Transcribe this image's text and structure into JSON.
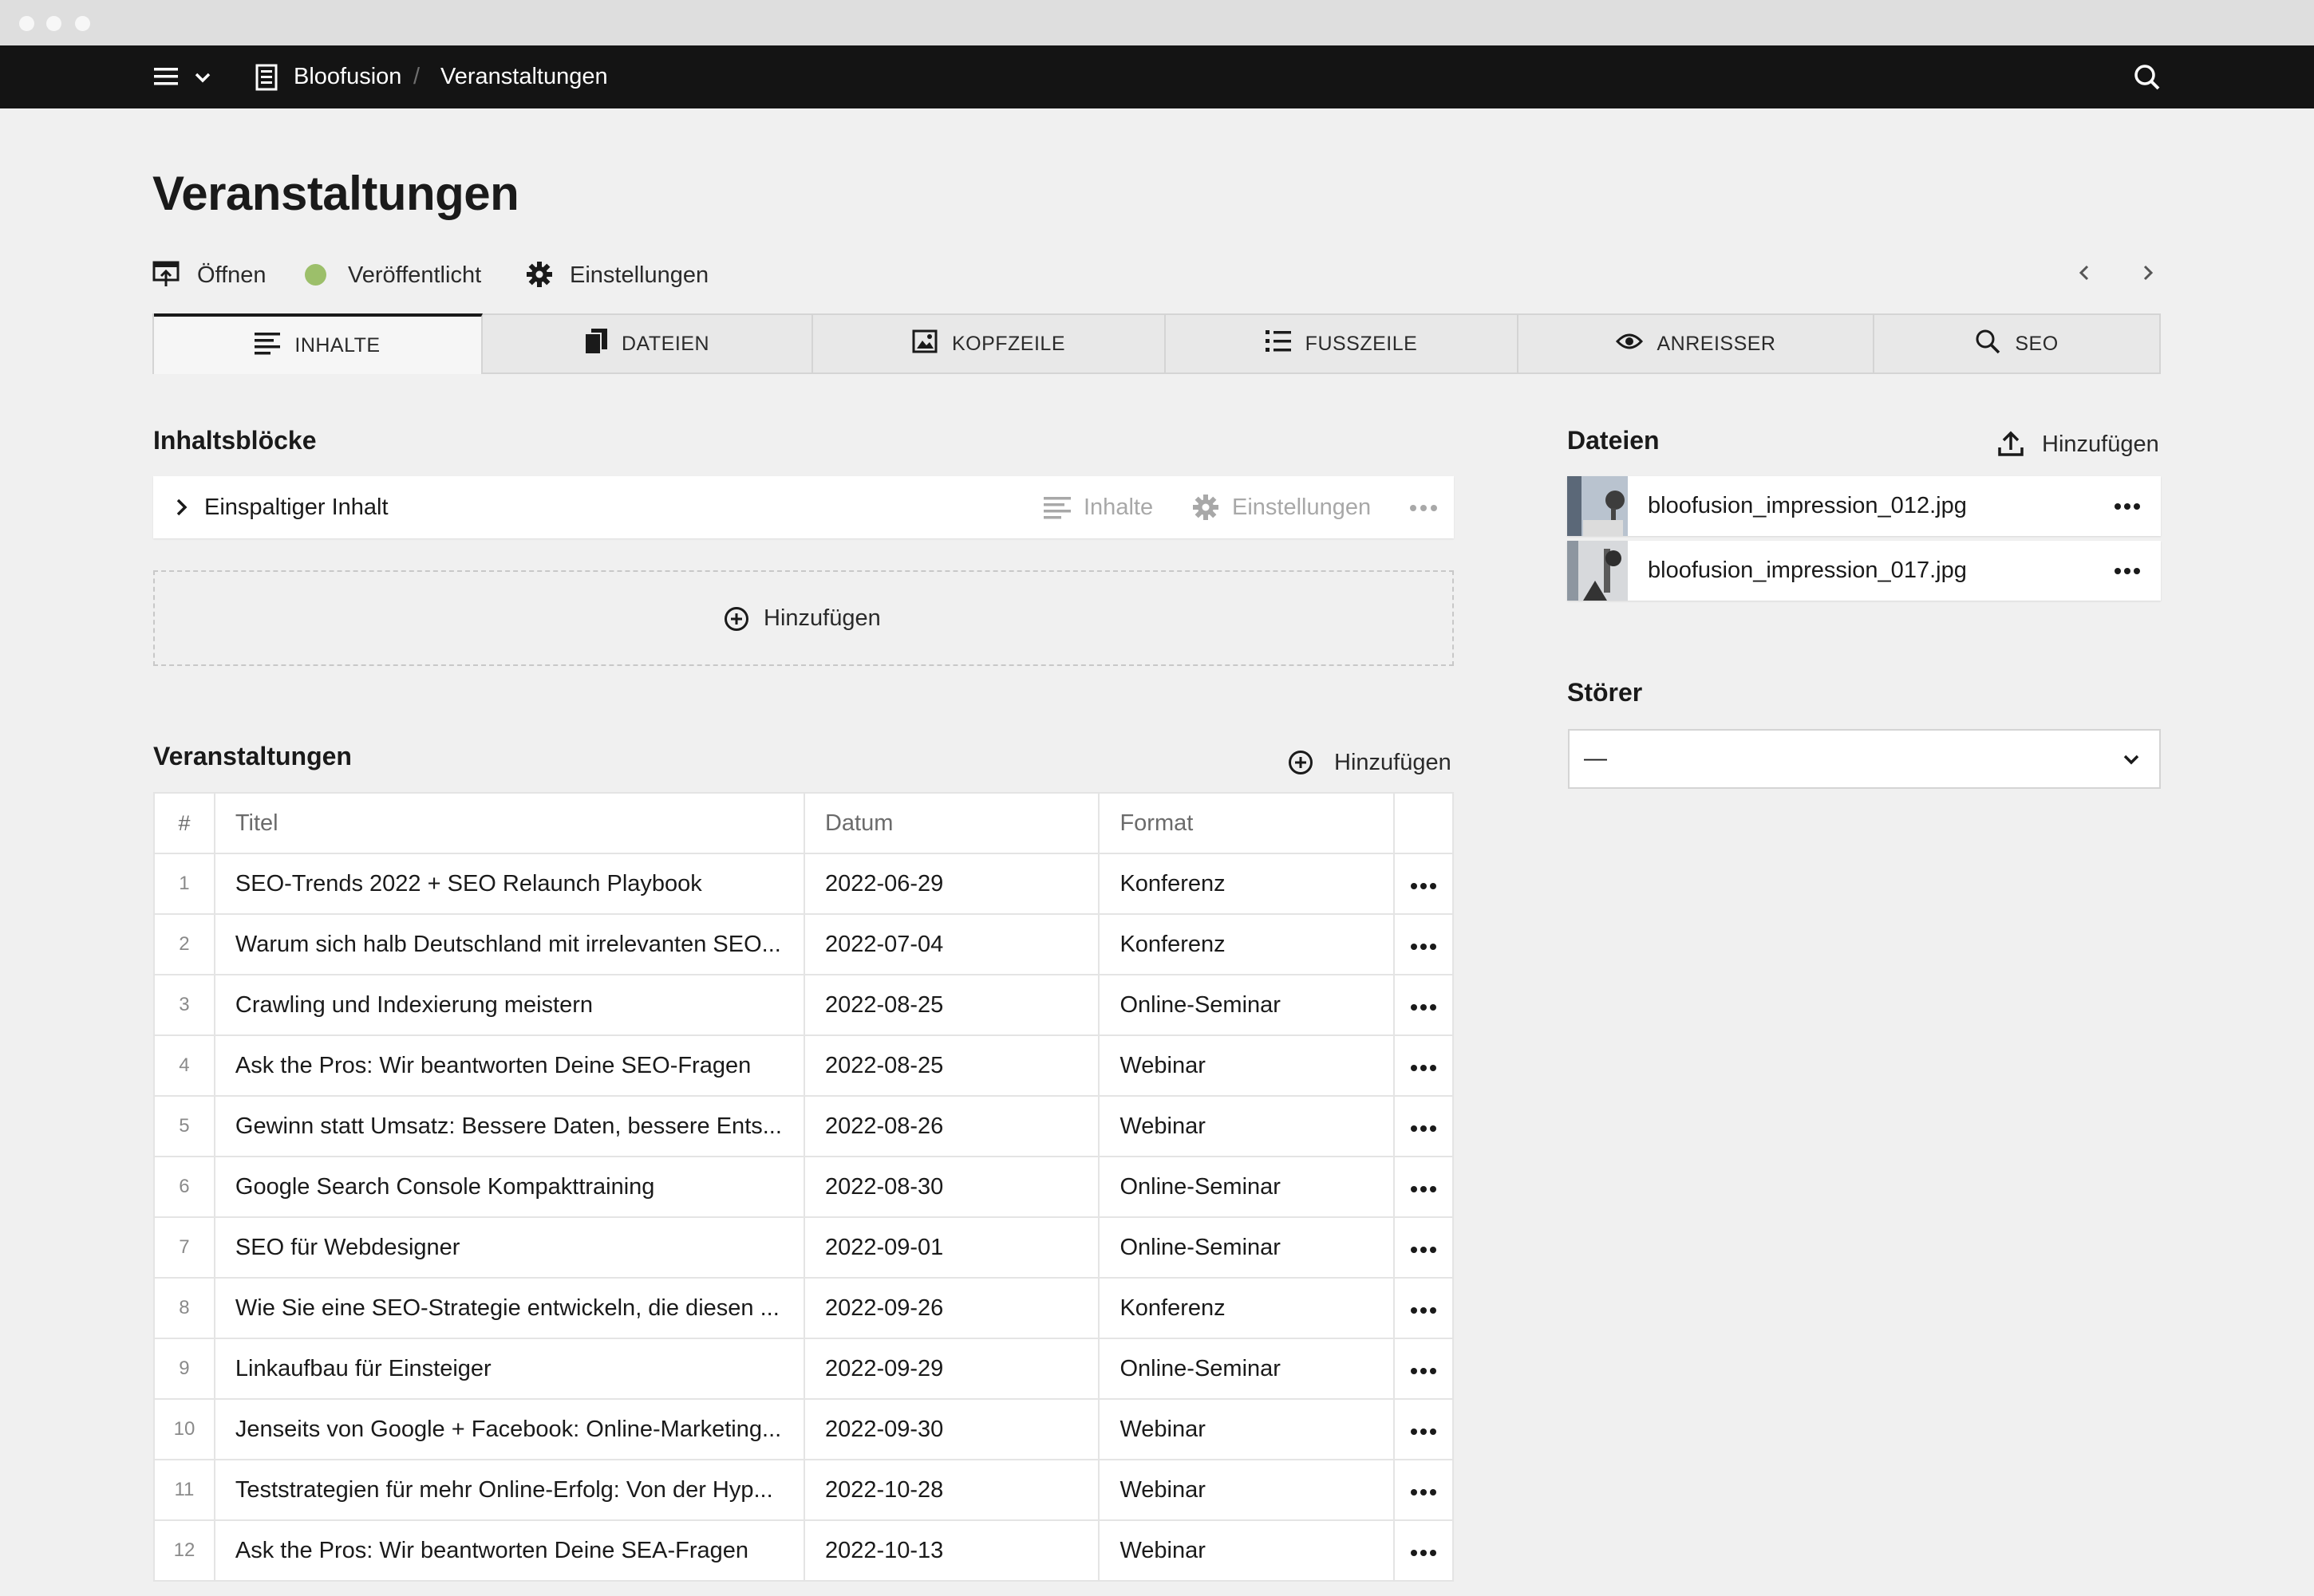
{
  "header": {
    "breadcrumb_root": "Bloofusion",
    "breadcrumb_separator": "/",
    "breadcrumb_current": "Veranstaltungen"
  },
  "page": {
    "title": "Veranstaltungen",
    "open_label": "Öffnen",
    "status_label": "Veröffentlicht",
    "status_color": "#9cbf6a",
    "settings_label": "Einstellungen"
  },
  "tabs": [
    {
      "label": "INHALTE",
      "icon": "lines-icon",
      "active": true
    },
    {
      "label": "DATEIEN",
      "icon": "files-icon"
    },
    {
      "label": "KOPFZEILE",
      "icon": "image-icon"
    },
    {
      "label": "FUSSZEILE",
      "icon": "list-icon"
    },
    {
      "label": "ANREISSER",
      "icon": "eye-icon"
    },
    {
      "label": "SEO",
      "icon": "search-icon"
    }
  ],
  "blocks": {
    "heading": "Inhaltsblöcke",
    "item_label": "Einspaltiger Inhalt",
    "item_content_label": "Inhalte",
    "item_settings_label": "Einstellungen",
    "add_label": "Hinzufügen"
  },
  "events": {
    "heading": "Veranstaltungen",
    "add_label": "Hinzufügen",
    "columns": {
      "num": "#",
      "title": "Titel",
      "date": "Datum",
      "format": "Format"
    },
    "rows": [
      {
        "num": "1",
        "title": "SEO-Trends 2022 + SEO Relaunch Playbook",
        "date": "2022-06-29",
        "format": "Konferenz"
      },
      {
        "num": "2",
        "title": "Warum sich halb Deutschland mit irrelevanten SEO...",
        "date": "2022-07-04",
        "format": "Konferenz"
      },
      {
        "num": "3",
        "title": "Crawling und Indexierung meistern",
        "date": "2022-08-25",
        "format": "Online-Seminar"
      },
      {
        "num": "4",
        "title": "Ask the Pros: Wir beantworten Deine SEO-Fragen",
        "date": "2022-08-25",
        "format": "Webinar"
      },
      {
        "num": "5",
        "title": "Gewinn statt Umsatz: Bessere Daten, bessere Ents...",
        "date": "2022-08-26",
        "format": "Webinar"
      },
      {
        "num": "6",
        "title": "Google Search Console Kompakttraining",
        "date": "2022-08-30",
        "format": "Online-Seminar"
      },
      {
        "num": "7",
        "title": "SEO für Webdesigner",
        "date": "2022-09-01",
        "format": "Online-Seminar"
      },
      {
        "num": "8",
        "title": "Wie Sie eine SEO-Strategie entwickeln, die diesen ...",
        "date": "2022-09-26",
        "format": "Konferenz"
      },
      {
        "num": "9",
        "title": "Linkaufbau für Einsteiger",
        "date": "2022-09-29",
        "format": "Online-Seminar"
      },
      {
        "num": "10",
        "title": "Jenseits von Google + Facebook: Online-Marketing...",
        "date": "2022-09-30",
        "format": "Webinar"
      },
      {
        "num": "11",
        "title": "Teststrategien für mehr Online-Erfolg: Von der Hyp...",
        "date": "2022-10-28",
        "format": "Webinar"
      },
      {
        "num": "12",
        "title": "Ask the Pros: Wir beantworten Deine SEA-Fragen",
        "date": "2022-10-13",
        "format": "Webinar"
      }
    ]
  },
  "files": {
    "heading": "Dateien",
    "upload_label": "Hinzufügen",
    "items": [
      {
        "name": "bloofusion_impression_012.jpg"
      },
      {
        "name": "bloofusion_impression_017.jpg"
      }
    ]
  },
  "stoerer": {
    "heading": "Störer",
    "selected": "—"
  }
}
